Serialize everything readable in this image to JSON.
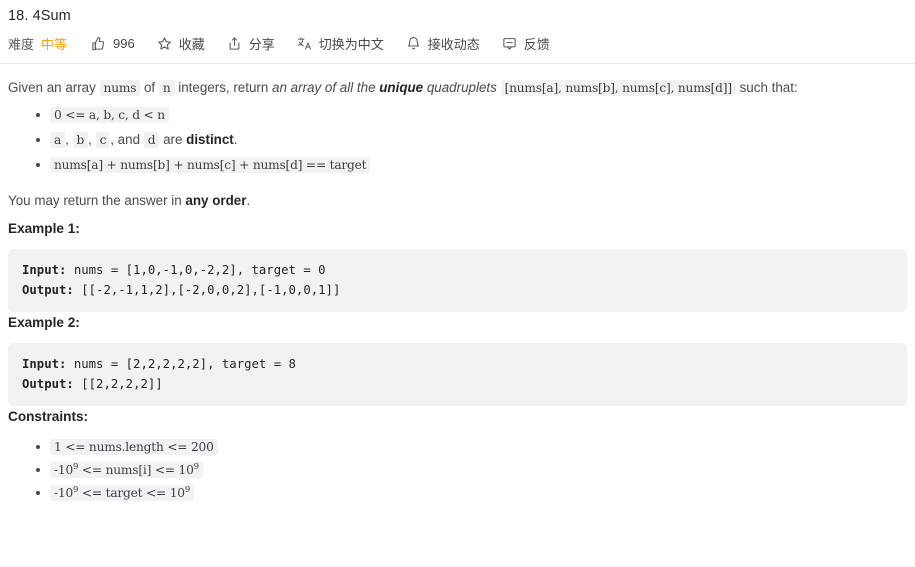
{
  "header": {
    "title": "18. 4Sum",
    "toolbar": {
      "difficulty_label": "难度",
      "difficulty_value": "中等",
      "difficulty_color": "#ffa116",
      "likes_count": "996",
      "favorite_label": "收藏",
      "share_label": "分享",
      "translate_label": "切换为中文",
      "subscribe_label": "接收动态",
      "feedback_label": "反馈",
      "icons": {
        "like": "thumbs-up-icon",
        "favorite": "star-icon",
        "share": "share-icon",
        "translate": "translate-icon",
        "subscribe": "bell-icon",
        "feedback": "comment-icon"
      }
    }
  },
  "description": {
    "p1": {
      "t1": "Given an array ",
      "c1": "nums",
      "t2": " of ",
      "c2": "n",
      "t3": " integers, return ",
      "i1": "an array of all the ",
      "b1": "unique",
      "i2": " quadruplets",
      "t4": " ",
      "c3": "[nums[a], nums[b], nums[c], nums[d]]",
      "t5": " such that:"
    },
    "bullets": [
      {
        "code": "0 <= a, b, c, d < n"
      },
      {
        "codes": [
          "a",
          "b",
          "c",
          "d"
        ],
        "sep1": ", ",
        "sep2": ", ",
        "sep3": ", and ",
        "tail_pre": " are ",
        "tail_bold": "distinct",
        "tail_post": "."
      },
      {
        "code": "nums[a] + nums[b] + nums[c] + nums[d] == target"
      }
    ],
    "p2": {
      "t1": "You may return the answer in ",
      "b1": "any order",
      "t2": "."
    }
  },
  "examples": [
    {
      "heading": "Example 1:",
      "input_label": "Input:",
      "input_value": " nums = [1,0,-1,0,-2,2], target = 0",
      "output_label": "Output:",
      "output_value": " [[-2,-1,1,2],[-2,0,0,2],[-1,0,0,1]]"
    },
    {
      "heading": "Example 2:",
      "input_label": "Input:",
      "input_value": " nums = [2,2,2,2,2], target = 8",
      "output_label": "Output:",
      "output_value": " [[2,2,2,2]]"
    }
  ],
  "constraints": {
    "heading": "Constraints:",
    "items": [
      {
        "pre": "1 <= nums.length <= 200",
        "sup": "",
        "post": ""
      },
      {
        "pre": "-10",
        "sup": "9",
        "mid": " <= nums[i] <= 10",
        "sup2": "9",
        "post": ""
      },
      {
        "pre": "-10",
        "sup": "9",
        "mid": " <= target <= 10",
        "sup2": "9",
        "post": ""
      }
    ]
  }
}
